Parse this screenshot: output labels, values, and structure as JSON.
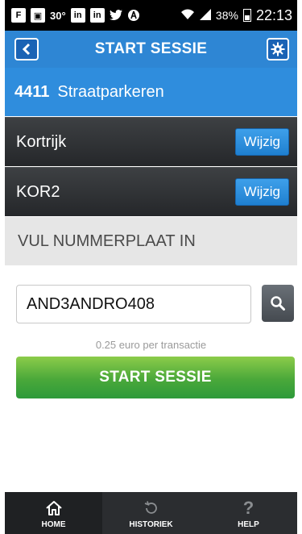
{
  "status_bar": {
    "left_icons": [
      "flipboard-icon",
      "gallery-icon",
      "temperature-icon",
      "linkedin-icon",
      "linkedin-icon",
      "twitter-icon",
      "app-icon"
    ],
    "temperature": "30°",
    "battery": "38%",
    "time": "22:13"
  },
  "header": {
    "title": "START SESSIE"
  },
  "zone": {
    "code": "4411",
    "name": "Straatparkeren"
  },
  "city_row": {
    "label": "Kortrijk",
    "button": "Wijzig"
  },
  "code_row": {
    "label": "KOR2",
    "button": "Wijzig"
  },
  "section": {
    "title": "VUL NUMMERPLAAT IN"
  },
  "plate": {
    "value": "AND3ANDRO408"
  },
  "fee_text": "0.25 euro per transactie",
  "start_button": "START SESSIE",
  "nav": [
    {
      "label": "HOME",
      "icon": "home-icon",
      "active": true
    },
    {
      "label": "HISTORIEK",
      "icon": "history-icon",
      "active": false
    },
    {
      "label": "HELP",
      "icon": "help-icon",
      "active": false
    }
  ],
  "colors": {
    "header": "#2e86d4",
    "zone": "#2f8ddd",
    "accent_green": "#4aa83a",
    "dark_row": "#2f3235"
  }
}
